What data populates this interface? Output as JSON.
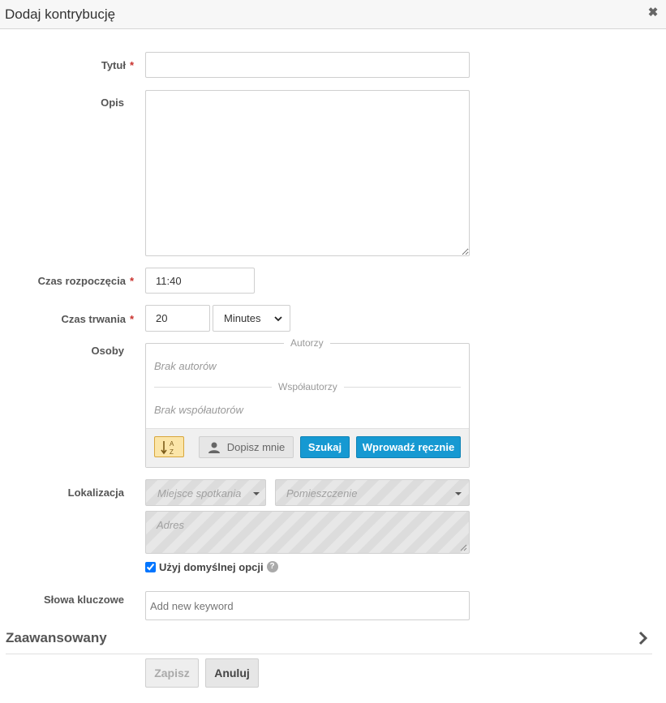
{
  "dialog": {
    "title": "Dodaj kontrybucję"
  },
  "form": {
    "title": {
      "label": "Tytuł",
      "required_mark": "*",
      "value": ""
    },
    "description": {
      "label": "Opis",
      "value": ""
    },
    "start_time": {
      "label": "Czas rozpoczęcia",
      "required_mark": "*",
      "value": "11:40"
    },
    "duration": {
      "label": "Czas trwania",
      "required_mark": "*",
      "value": "20",
      "unit": "Minutes"
    },
    "persons": {
      "label": "Osoby",
      "authors_legend": "Autorzy",
      "authors_empty": "Brak autorów",
      "coauthors_legend": "Współautorzy",
      "coauthors_empty": "Brak współautorów",
      "sort_icon_text": "A Z",
      "add_me_label": "Dopisz mnie",
      "search_label": "Szukaj",
      "manual_label": "Wprowadź ręcznie"
    },
    "location": {
      "label": "Lokalizacja",
      "venue_placeholder": "Miejsce spotkania",
      "room_placeholder": "Pomieszczenie",
      "address_placeholder": "Adres",
      "use_default_label": "Użyj domyślnej opcji",
      "use_default_checked": true
    },
    "keywords": {
      "label": "Słowa kluczowe",
      "placeholder": "Add new keyword"
    }
  },
  "advanced": {
    "label": "Zaawansowany"
  },
  "actions": {
    "save_label": "Zapisz",
    "cancel_label": "Anuluj"
  },
  "colors": {
    "accent": "#1699d2",
    "required": "#c9302c",
    "sort_button": "#fbe5a8"
  }
}
